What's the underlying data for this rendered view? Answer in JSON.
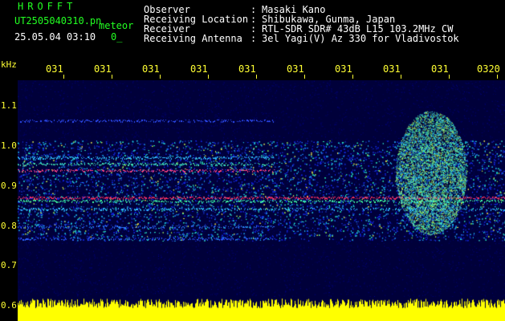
{
  "header": {
    "app_title": "HROFFT",
    "file_name": "UT2505040310.pn",
    "file_suffix": "meteor",
    "datetime": "25.05.04 03:10",
    "extra": "0_"
  },
  "info": [
    {
      "label": "Observer",
      "value": "Masaki Kano"
    },
    {
      "label": "Receiving Location",
      "value": "Shibukawa, Gunma, Japan"
    },
    {
      "label": "Receiver",
      "value": "RTL-SDR SDR# 43dB L15 103.2MHz CW"
    },
    {
      "label": "Receiving Antenna",
      "value": "3el Yagi(V) Az 330 for Vladivostok"
    }
  ],
  "axis": {
    "y_unit": "kHz",
    "y_ticks": [
      "1.1",
      "1.0",
      "0.9",
      "0.8",
      "0.7",
      "0.6"
    ],
    "x_ticks": [
      "031",
      "031",
      "031",
      "031",
      "031",
      "031",
      "031",
      "031",
      "031",
      "0320"
    ]
  },
  "colors": {
    "header_green": "#22ff22",
    "label_white": "#ffffff",
    "axis_yellow": "#ffff33",
    "background": "#000000"
  }
}
